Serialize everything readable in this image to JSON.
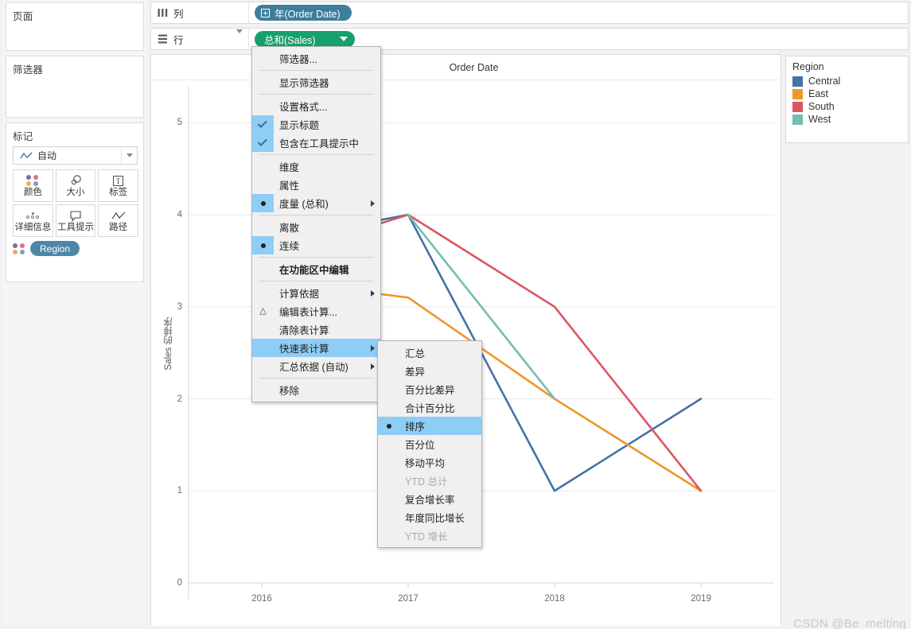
{
  "shelves": {
    "columns": {
      "label": "列",
      "icon": "columns-icon",
      "pill": "年(Order Date)"
    },
    "rows": {
      "label": "行",
      "icon": "rows-icon",
      "pill": "总和(Sales)"
    }
  },
  "sidebar": {
    "pages": {
      "title": "页面"
    },
    "filters": {
      "title": "筛选器"
    },
    "marks": {
      "title": "标记",
      "type_selected": "自动",
      "buttons": [
        {
          "name": "color",
          "label": "颜色",
          "icon": "color-dots-icon"
        },
        {
          "name": "size",
          "label": "大小",
          "icon": "size-circles-icon"
        },
        {
          "name": "label",
          "label": "标签",
          "icon": "text-label-icon"
        },
        {
          "name": "detail",
          "label": "详细信息",
          "icon": "detail-dots-icon"
        },
        {
          "name": "tooltip",
          "label": "工具提示",
          "icon": "tooltip-bubble-icon"
        },
        {
          "name": "path",
          "label": "路径",
          "icon": "path-line-icon"
        }
      ],
      "pills": [
        {
          "label": "Region",
          "icon": "color-dots-icon"
        }
      ]
    }
  },
  "legend": {
    "title": "Region",
    "items": [
      {
        "label": "Central",
        "color": "#4572a7"
      },
      {
        "label": "East",
        "color": "#f0962b"
      },
      {
        "label": "South",
        "color": "#dc5662"
      },
      {
        "label": "West",
        "color": "#74bdb2"
      }
    ]
  },
  "context_menu": {
    "items": [
      {
        "label": "筛选器...",
        "type": "item"
      },
      {
        "type": "separator"
      },
      {
        "label": "显示筛选器",
        "type": "item"
      },
      {
        "type": "separator"
      },
      {
        "label": "设置格式...",
        "type": "item"
      },
      {
        "label": "显示标题",
        "type": "item",
        "mark": "check"
      },
      {
        "label": "包含在工具提示中",
        "type": "item",
        "mark": "check"
      },
      {
        "type": "separator"
      },
      {
        "label": "维度",
        "type": "item"
      },
      {
        "label": "属性",
        "type": "item"
      },
      {
        "label": "度量 (总和)",
        "type": "item",
        "mark": "radio",
        "submenu": true
      },
      {
        "type": "separator"
      },
      {
        "label": "离散",
        "type": "item"
      },
      {
        "label": "连续",
        "type": "item",
        "mark": "radio"
      },
      {
        "type": "separator"
      },
      {
        "label": "在功能区中编辑",
        "type": "item",
        "bold": true
      },
      {
        "type": "separator"
      },
      {
        "label": "计算依据",
        "type": "item",
        "submenu": true
      },
      {
        "label": "编辑表计算...",
        "type": "item",
        "icon": "triangle-icon"
      },
      {
        "label": "清除表计算",
        "type": "item"
      },
      {
        "label": "快速表计算",
        "type": "item",
        "submenu": true,
        "highlighted": true
      },
      {
        "label": "汇总依据 (自动)",
        "type": "item",
        "submenu": true
      },
      {
        "type": "separator"
      },
      {
        "label": "移除",
        "type": "item"
      }
    ]
  },
  "submenu": {
    "items": [
      {
        "label": "汇总",
        "disabled": false
      },
      {
        "label": "差异",
        "disabled": false
      },
      {
        "label": "百分比差异",
        "disabled": false
      },
      {
        "label": "合计百分比",
        "disabled": false
      },
      {
        "label": "排序",
        "disabled": false,
        "selected": true
      },
      {
        "label": "百分位",
        "disabled": false
      },
      {
        "label": "移动平均",
        "disabled": false
      },
      {
        "label": "YTD 总计",
        "disabled": true
      },
      {
        "label": "复合增长率",
        "disabled": false
      },
      {
        "label": "年度同比增长",
        "disabled": false
      },
      {
        "label": "YTD 增长",
        "disabled": true
      }
    ]
  },
  "watermark": "CSDN @Be_melting",
  "chart_data": {
    "type": "line",
    "title": "Order Date",
    "xlabel": "",
    "ylabel": "Sales 的排序",
    "x": [
      "2016",
      "2017",
      "2018",
      "2019"
    ],
    "ylim": [
      0,
      5.4
    ],
    "yticks": [
      0,
      1,
      2,
      3,
      4,
      5
    ],
    "grid": true,
    "legend_position": "right",
    "series": [
      {
        "name": "Central",
        "color": "#4572a7",
        "values": [
          3.7,
          4.0,
          1.0,
          2.0
        ]
      },
      {
        "name": "East",
        "color": "#f0962b",
        "values": [
          3.3,
          3.1,
          2.0,
          1.0
        ]
      },
      {
        "name": "South",
        "color": "#dc5662",
        "values": [
          3.5,
          4.0,
          3.0,
          1.0
        ]
      },
      {
        "name": "West",
        "color": "#74bdb2",
        "values": [
          null,
          4.0,
          2.0,
          null
        ]
      }
    ]
  }
}
